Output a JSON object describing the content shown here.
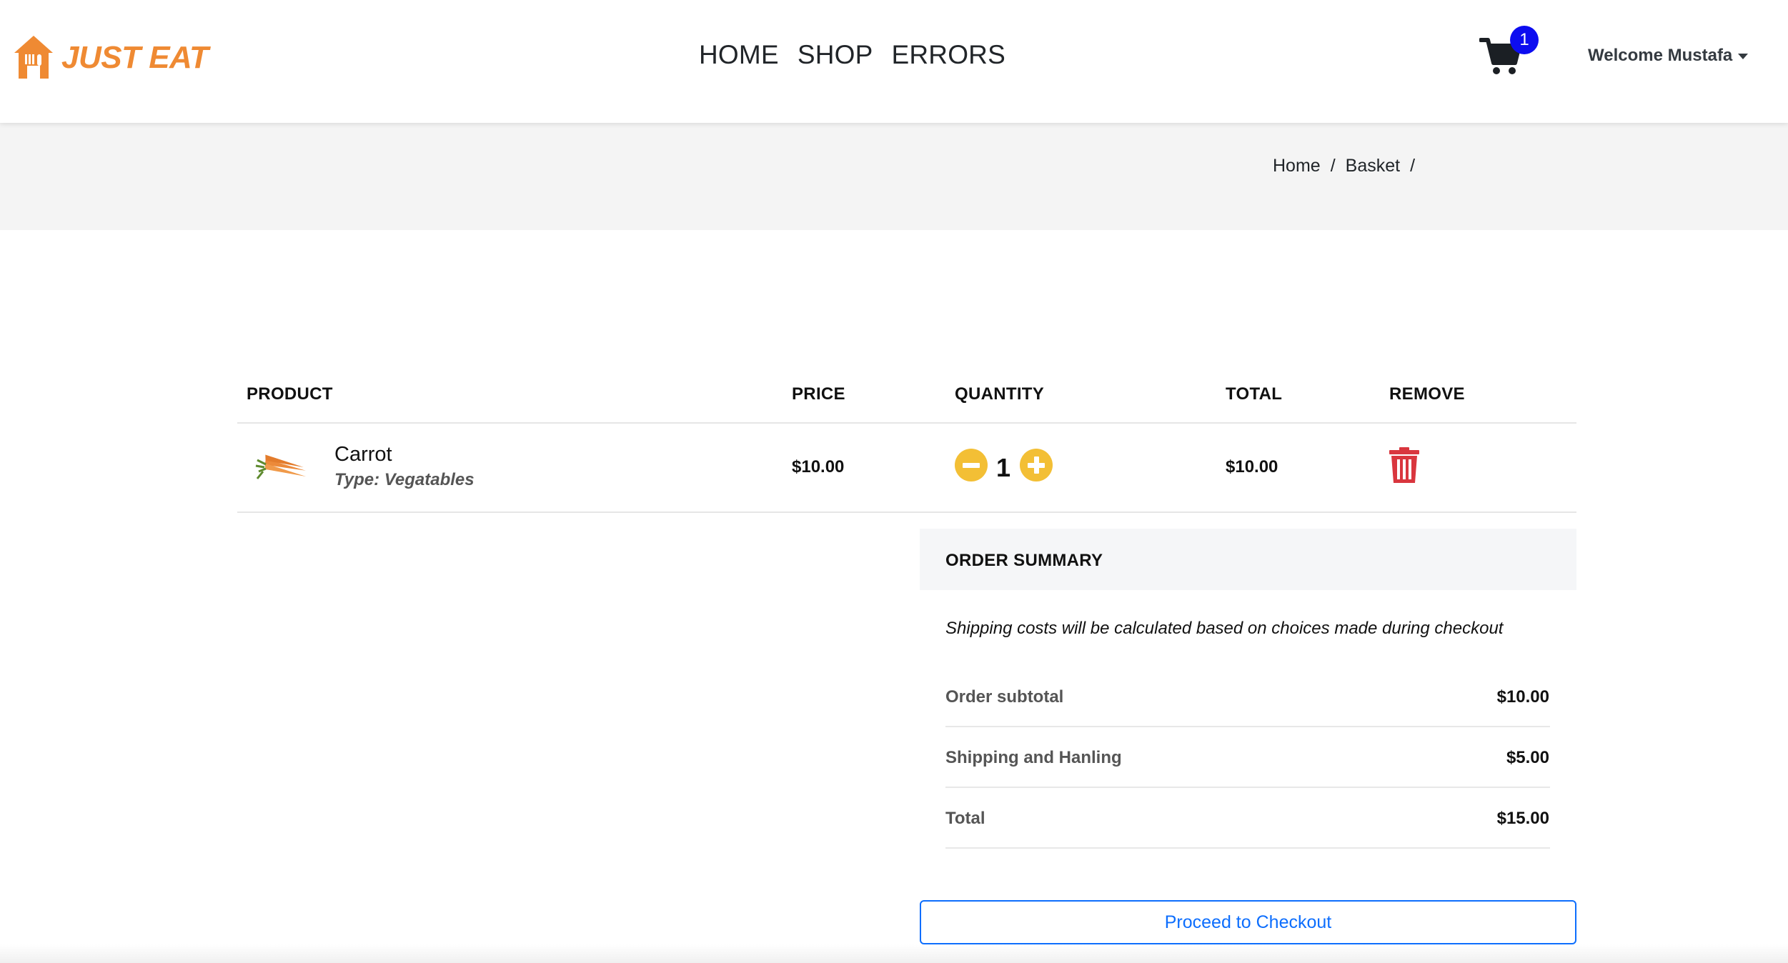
{
  "brand": {
    "name": "JUST EAT",
    "color": "#ef8a33",
    "icon": "house-fork-knife-icon"
  },
  "nav": {
    "items": [
      "HOME",
      "SHOP",
      "ERRORS"
    ]
  },
  "cart": {
    "icon": "shopping-cart-icon",
    "count": "1",
    "badge_color": "#0d0df0"
  },
  "user": {
    "greeting": "Welcome Mustafa"
  },
  "breadcrumb": {
    "items": [
      "Home",
      "Basket"
    ],
    "separator": "/"
  },
  "table": {
    "headers": {
      "product": "PRODUCT",
      "price": "PRICE",
      "quantity": "QUANTITY",
      "total": "TOTAL",
      "remove": "REMOVE"
    },
    "rows": [
      {
        "name": "Carrot",
        "type": "Type: Vegatables",
        "image": "carrot-image",
        "price": "$10.00",
        "quantity": "1",
        "total": "$10.00"
      }
    ]
  },
  "summary": {
    "title": "ORDER SUMMARY",
    "note": "Shipping costs will be calculated based on choices made during checkout",
    "rows": [
      {
        "label": "Order subtotal",
        "value": "$10.00"
      },
      {
        "label": "Shipping and Hanling",
        "value": "$5.00"
      },
      {
        "label": "Total",
        "value": "$15.00"
      }
    ]
  },
  "checkout": {
    "label": "Proceed to Checkout",
    "color": "#0d6efd"
  },
  "colors": {
    "quantity_buttons": "#f3bf35",
    "trash": "#d9363e"
  }
}
